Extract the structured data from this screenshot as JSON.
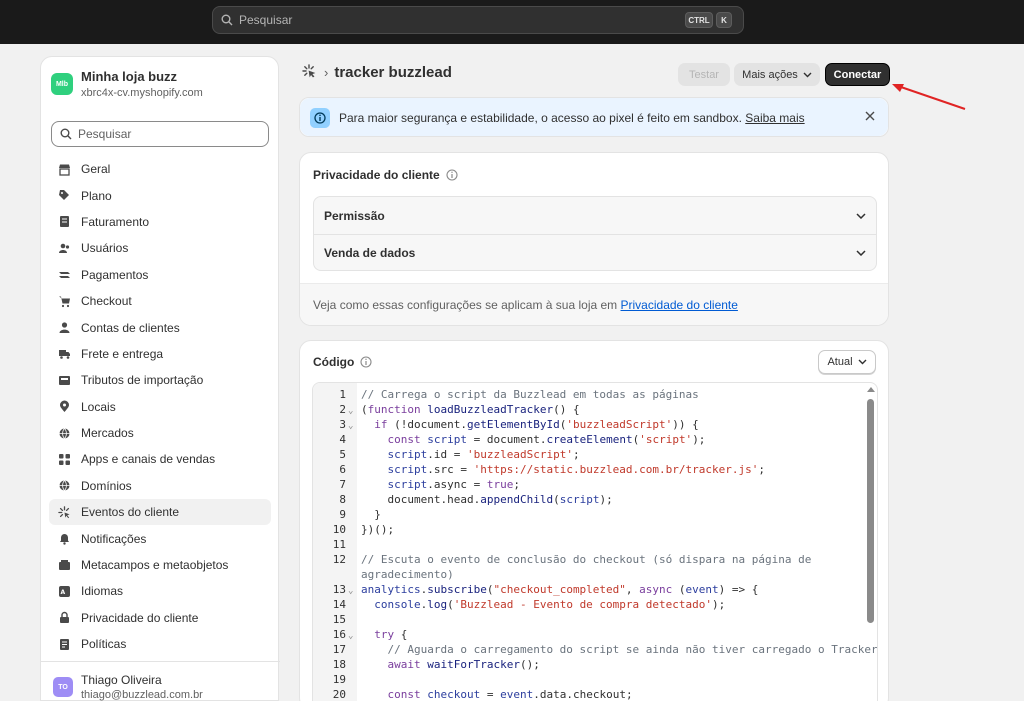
{
  "topbar": {
    "search_placeholder": "Pesquisar",
    "kbd_ctrl": "CTRL",
    "kbd_k": "K"
  },
  "store": {
    "avatar": "Mlb",
    "name": "Minha loja buzz",
    "domain": "xbrc4x-cv.myshopify.com"
  },
  "sidebar": {
    "search_placeholder": "Pesquisar",
    "items": [
      {
        "label": "Geral",
        "icon": "store-icon"
      },
      {
        "label": "Plano",
        "icon": "plan-icon"
      },
      {
        "label": "Faturamento",
        "icon": "billing-icon"
      },
      {
        "label": "Usuários",
        "icon": "users-icon"
      },
      {
        "label": "Pagamentos",
        "icon": "payments-icon"
      },
      {
        "label": "Checkout",
        "icon": "cart-icon"
      },
      {
        "label": "Contas de clientes",
        "icon": "person-icon"
      },
      {
        "label": "Frete e entrega",
        "icon": "truck-icon"
      },
      {
        "label": "Tributos de importação",
        "icon": "duties-icon"
      },
      {
        "label": "Locais",
        "icon": "location-icon"
      },
      {
        "label": "Mercados",
        "icon": "globe-icon"
      },
      {
        "label": "Apps e canais de vendas",
        "icon": "apps-icon"
      },
      {
        "label": "Domínios",
        "icon": "globe-icon"
      },
      {
        "label": "Eventos do cliente",
        "icon": "events-icon"
      },
      {
        "label": "Notificações",
        "icon": "bell-icon"
      },
      {
        "label": "Metacampos e metaobjetos",
        "icon": "metafields-icon"
      },
      {
        "label": "Idiomas",
        "icon": "language-icon"
      },
      {
        "label": "Privacidade do cliente",
        "icon": "lock-icon"
      },
      {
        "label": "Políticas",
        "icon": "policy-icon"
      }
    ],
    "active_index": 13
  },
  "user": {
    "avatar": "TO",
    "name": "Thiago Oliveira",
    "email": "thiago@buzzlead.com.br"
  },
  "header": {
    "title": "tracker buzzlead",
    "test_label": "Testar",
    "more_label": "Mais ações",
    "connect_label": "Conectar"
  },
  "banner": {
    "text": "Para maior segurança e estabilidade, o acesso ao pixel é feito em sandbox.",
    "link": "Saiba mais"
  },
  "privacy": {
    "title": "Privacidade do cliente",
    "rows": [
      "Permissão",
      "Venda de dados"
    ],
    "footer_text": "Veja como essas configurações se aplicam à sua loja em",
    "footer_link": "Privacidade do cliente"
  },
  "code": {
    "title": "Código",
    "version_label": "Atual",
    "lines": [
      {
        "n": "1",
        "fold": false,
        "html": "<span class='c-cm'>// Carrega o script da Buzzlead em todas as páginas</span>"
      },
      {
        "n": "2",
        "fold": true,
        "html": "(<span class='c-kw'>function</span> <span class='c-fn'>loadBuzzleadTracker</span>() {"
      },
      {
        "n": "3",
        "fold": true,
        "html": "  <span class='c-kw'>if</span> (!document.<span class='c-fn'>getElementById</span>(<span class='c-str'>'buzzleadScript'</span>)) {"
      },
      {
        "n": "4",
        "fold": false,
        "html": "    <span class='c-kw'>const</span> <span class='c-var'>script</span> = document.<span class='c-fn'>createElement</span>(<span class='c-str'>'script'</span>);"
      },
      {
        "n": "5",
        "fold": false,
        "html": "    <span class='c-var'>script</span>.id = <span class='c-str'>'buzzleadScript'</span>;"
      },
      {
        "n": "6",
        "fold": false,
        "html": "    <span class='c-var'>script</span>.src = <span class='c-str'>'https://static.buzzlead.com.br/tracker.js'</span>;"
      },
      {
        "n": "7",
        "fold": false,
        "html": "    <span class='c-var'>script</span>.async = <span class='c-kw'>true</span>;"
      },
      {
        "n": "8",
        "fold": false,
        "html": "    document.head.<span class='c-fn'>appendChild</span>(<span class='c-var'>script</span>);"
      },
      {
        "n": "9",
        "fold": false,
        "html": "  }"
      },
      {
        "n": "10",
        "fold": false,
        "html": "})();"
      },
      {
        "n": "11",
        "fold": false,
        "html": ""
      },
      {
        "n": "12",
        "fold": false,
        "html": "<span class='c-cm'>// Escuta o evento de conclusão do checkout (só dispara na página de</span>"
      },
      {
        "n": "",
        "fold": false,
        "html": "<span class='c-cm'>agradecimento)</span>"
      },
      {
        "n": "13",
        "fold": true,
        "html": "<span class='c-var'>analytics</span>.<span class='c-fn'>subscribe</span>(<span class='c-str'>\"checkout_completed\"</span>, <span class='c-kw'>async</span> (<span class='c-var'>event</span>) => {"
      },
      {
        "n": "14",
        "fold": false,
        "html": "  <span class='c-var'>console</span>.<span class='c-fn'>log</span>(<span class='c-str'>'Buzzlead - Evento de compra detectado'</span>);"
      },
      {
        "n": "15",
        "fold": false,
        "html": ""
      },
      {
        "n": "16",
        "fold": true,
        "html": "  <span class='c-kw'>try</span> {"
      },
      {
        "n": "17",
        "fold": false,
        "html": "    <span class='c-cm'>// Aguarda o carregamento do script se ainda não tiver carregado o Tracker</span>"
      },
      {
        "n": "18",
        "fold": false,
        "html": "    <span class='c-kw'>await</span> <span class='c-fn'>waitForTracker</span>();"
      },
      {
        "n": "19",
        "fold": false,
        "html": ""
      },
      {
        "n": "20",
        "fold": false,
        "html": "    <span class='c-kw'>const</span> <span class='c-var'>checkout</span> = <span class='c-var'>event</span>.data.checkout;"
      }
    ]
  },
  "colors": {
    "accent": "#303030",
    "link": "#005bd3",
    "banner_bg": "#eaf4ff",
    "arrow": "#e02424"
  }
}
